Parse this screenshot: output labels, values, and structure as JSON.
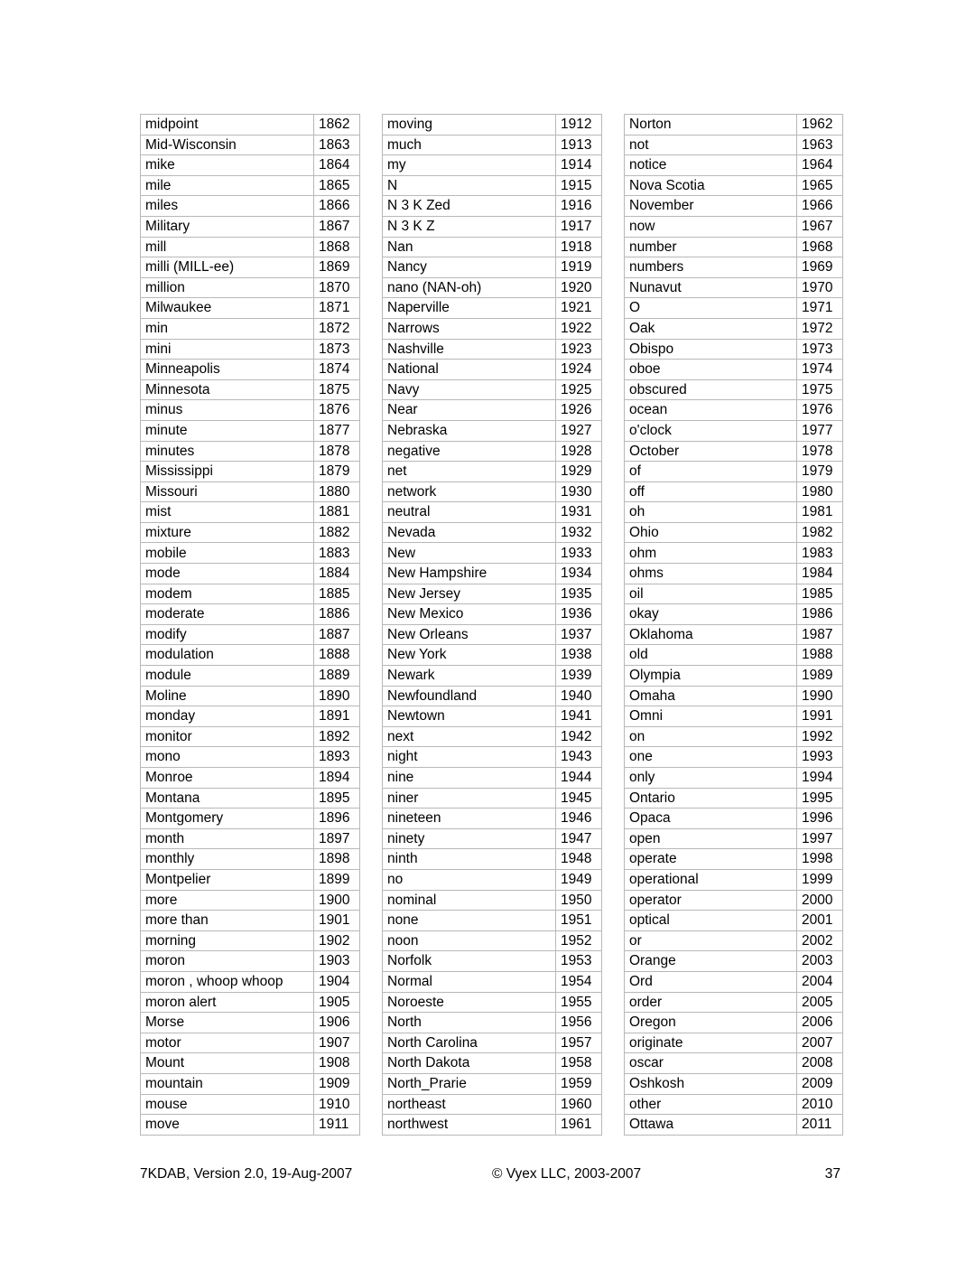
{
  "document": {
    "page_number": "37",
    "footer_left": "7KDAB, Version 2.0, 19-Aug-2007",
    "footer_center": "© Vyex LLC, 2003-2007"
  },
  "columns": [
    {
      "name": "column-1",
      "rows": [
        {
          "term": "midpoint",
          "code": "1862"
        },
        {
          "term": "Mid-Wisconsin",
          "code": "1863"
        },
        {
          "term": "mike",
          "code": "1864"
        },
        {
          "term": "mile",
          "code": "1865"
        },
        {
          "term": "miles",
          "code": "1866"
        },
        {
          "term": "Military",
          "code": "1867"
        },
        {
          "term": "mill",
          "code": "1868"
        },
        {
          "term": "milli (MILL-ee)",
          "code": "1869"
        },
        {
          "term": "million",
          "code": "1870"
        },
        {
          "term": "Milwaukee",
          "code": "1871"
        },
        {
          "term": "min",
          "code": "1872"
        },
        {
          "term": "mini",
          "code": "1873"
        },
        {
          "term": "Minneapolis",
          "code": "1874"
        },
        {
          "term": "Minnesota",
          "code": "1875"
        },
        {
          "term": "minus",
          "code": "1876"
        },
        {
          "term": "minute",
          "code": "1877"
        },
        {
          "term": "minutes",
          "code": "1878"
        },
        {
          "term": "Mississippi",
          "code": "1879"
        },
        {
          "term": "Missouri",
          "code": "1880"
        },
        {
          "term": "mist",
          "code": "1881"
        },
        {
          "term": "mixture",
          "code": "1882"
        },
        {
          "term": "mobile",
          "code": "1883"
        },
        {
          "term": "mode",
          "code": "1884"
        },
        {
          "term": "modem",
          "code": "1885"
        },
        {
          "term": "moderate",
          "code": "1886"
        },
        {
          "term": "modify",
          "code": "1887"
        },
        {
          "term": "modulation",
          "code": "1888"
        },
        {
          "term": "module",
          "code": "1889"
        },
        {
          "term": "Moline",
          "code": "1890"
        },
        {
          "term": "monday",
          "code": "1891"
        },
        {
          "term": "monitor",
          "code": "1892"
        },
        {
          "term": "mono",
          "code": "1893"
        },
        {
          "term": "Monroe",
          "code": "1894"
        },
        {
          "term": "Montana",
          "code": "1895"
        },
        {
          "term": "Montgomery",
          "code": "1896"
        },
        {
          "term": "month",
          "code": "1897"
        },
        {
          "term": "monthly",
          "code": "1898"
        },
        {
          "term": "Montpelier",
          "code": "1899"
        },
        {
          "term": "more",
          "code": "1900"
        },
        {
          "term": "more than",
          "code": "1901"
        },
        {
          "term": "morning",
          "code": "1902"
        },
        {
          "term": "moron",
          "code": "1903"
        },
        {
          "term": "moron , whoop whoop",
          "code": "1904"
        },
        {
          "term": "moron alert",
          "code": "1905"
        },
        {
          "term": "Morse",
          "code": "1906"
        },
        {
          "term": "motor",
          "code": "1907"
        },
        {
          "term": "Mount",
          "code": "1908"
        },
        {
          "term": "mountain",
          "code": "1909"
        },
        {
          "term": "mouse",
          "code": "1910"
        },
        {
          "term": "move",
          "code": "1911"
        }
      ]
    },
    {
      "name": "column-2",
      "rows": [
        {
          "term": "moving",
          "code": "1912"
        },
        {
          "term": "much",
          "code": "1913"
        },
        {
          "term": "my",
          "code": "1914"
        },
        {
          "term": "N",
          "code": "1915"
        },
        {
          "term": "N 3 K Zed",
          "code": "1916"
        },
        {
          "term": "N 3 K Z",
          "code": "1917"
        },
        {
          "term": "Nan",
          "code": "1918"
        },
        {
          "term": "Nancy",
          "code": "1919"
        },
        {
          "term": "nano (NAN-oh)",
          "code": "1920"
        },
        {
          "term": "Naperville",
          "code": "1921"
        },
        {
          "term": "Narrows",
          "code": "1922"
        },
        {
          "term": "Nashville",
          "code": "1923"
        },
        {
          "term": "National",
          "code": "1924"
        },
        {
          "term": "Navy",
          "code": "1925"
        },
        {
          "term": "Near",
          "code": "1926"
        },
        {
          "term": "Nebraska",
          "code": "1927"
        },
        {
          "term": "negative",
          "code": "1928"
        },
        {
          "term": "net",
          "code": "1929"
        },
        {
          "term": "network",
          "code": "1930"
        },
        {
          "term": "neutral",
          "code": "1931"
        },
        {
          "term": "Nevada",
          "code": "1932"
        },
        {
          "term": "New",
          "code": "1933"
        },
        {
          "term": "New Hampshire",
          "code": "1934"
        },
        {
          "term": "New Jersey",
          "code": "1935"
        },
        {
          "term": "New Mexico",
          "code": "1936"
        },
        {
          "term": "New Orleans",
          "code": "1937"
        },
        {
          "term": "New York",
          "code": "1938"
        },
        {
          "term": "Newark",
          "code": "1939"
        },
        {
          "term": "Newfoundland",
          "code": "1940"
        },
        {
          "term": "Newtown",
          "code": "1941"
        },
        {
          "term": "next",
          "code": "1942"
        },
        {
          "term": "night",
          "code": "1943"
        },
        {
          "term": "nine",
          "code": "1944"
        },
        {
          "term": "niner",
          "code": "1945"
        },
        {
          "term": "nineteen",
          "code": "1946"
        },
        {
          "term": "ninety",
          "code": "1947"
        },
        {
          "term": "ninth",
          "code": "1948"
        },
        {
          "term": "no",
          "code": "1949"
        },
        {
          "term": "nominal",
          "code": "1950"
        },
        {
          "term": "none",
          "code": "1951"
        },
        {
          "term": "noon",
          "code": "1952"
        },
        {
          "term": "Norfolk",
          "code": "1953"
        },
        {
          "term": "Normal",
          "code": "1954"
        },
        {
          "term": "Noroeste",
          "code": "1955"
        },
        {
          "term": "North",
          "code": "1956"
        },
        {
          "term": "North Carolina",
          "code": "1957"
        },
        {
          "term": "North Dakota",
          "code": "1958"
        },
        {
          "term": "North_Prarie",
          "code": "1959"
        },
        {
          "term": "northeast",
          "code": "1960"
        },
        {
          "term": "northwest",
          "code": "1961"
        }
      ]
    },
    {
      "name": "column-3",
      "rows": [
        {
          "term": "Norton",
          "code": "1962"
        },
        {
          "term": "not",
          "code": "1963"
        },
        {
          "term": "notice",
          "code": "1964"
        },
        {
          "term": "Nova Scotia",
          "code": "1965"
        },
        {
          "term": "November",
          "code": "1966"
        },
        {
          "term": "now",
          "code": "1967"
        },
        {
          "term": "number",
          "code": "1968"
        },
        {
          "term": "numbers",
          "code": "1969"
        },
        {
          "term": "Nunavut",
          "code": "1970"
        },
        {
          "term": "O",
          "code": "1971"
        },
        {
          "term": "Oak",
          "code": "1972"
        },
        {
          "term": "Obispo",
          "code": "1973"
        },
        {
          "term": "oboe",
          "code": "1974"
        },
        {
          "term": "obscured",
          "code": "1975"
        },
        {
          "term": "ocean",
          "code": "1976"
        },
        {
          "term": "o'clock",
          "code": "1977"
        },
        {
          "term": "October",
          "code": "1978"
        },
        {
          "term": "of",
          "code": "1979"
        },
        {
          "term": "off",
          "code": "1980"
        },
        {
          "term": "oh",
          "code": "1981"
        },
        {
          "term": "Ohio",
          "code": "1982"
        },
        {
          "term": "ohm",
          "code": "1983"
        },
        {
          "term": "ohms",
          "code": "1984"
        },
        {
          "term": "oil",
          "code": "1985"
        },
        {
          "term": "okay",
          "code": "1986"
        },
        {
          "term": "Oklahoma",
          "code": "1987"
        },
        {
          "term": "old",
          "code": "1988"
        },
        {
          "term": "Olympia",
          "code": "1989"
        },
        {
          "term": "Omaha",
          "code": "1990"
        },
        {
          "term": "Omni",
          "code": "1991"
        },
        {
          "term": "on",
          "code": "1992"
        },
        {
          "term": "one",
          "code": "1993"
        },
        {
          "term": "only",
          "code": "1994"
        },
        {
          "term": "Ontario",
          "code": "1995"
        },
        {
          "term": "Opaca",
          "code": "1996"
        },
        {
          "term": "open",
          "code": "1997"
        },
        {
          "term": "operate",
          "code": "1998"
        },
        {
          "term": "operational",
          "code": "1999"
        },
        {
          "term": "operator",
          "code": "2000"
        },
        {
          "term": "optical",
          "code": "2001"
        },
        {
          "term": "or",
          "code": "2002"
        },
        {
          "term": "Orange",
          "code": "2003"
        },
        {
          "term": "Ord",
          "code": "2004"
        },
        {
          "term": "order",
          "code": "2005"
        },
        {
          "term": "Oregon",
          "code": "2006"
        },
        {
          "term": "originate",
          "code": "2007"
        },
        {
          "term": "oscar",
          "code": "2008"
        },
        {
          "term": "Oshkosh",
          "code": "2009"
        },
        {
          "term": "other",
          "code": "2010"
        },
        {
          "term": "Ottawa",
          "code": "2011"
        }
      ]
    }
  ]
}
